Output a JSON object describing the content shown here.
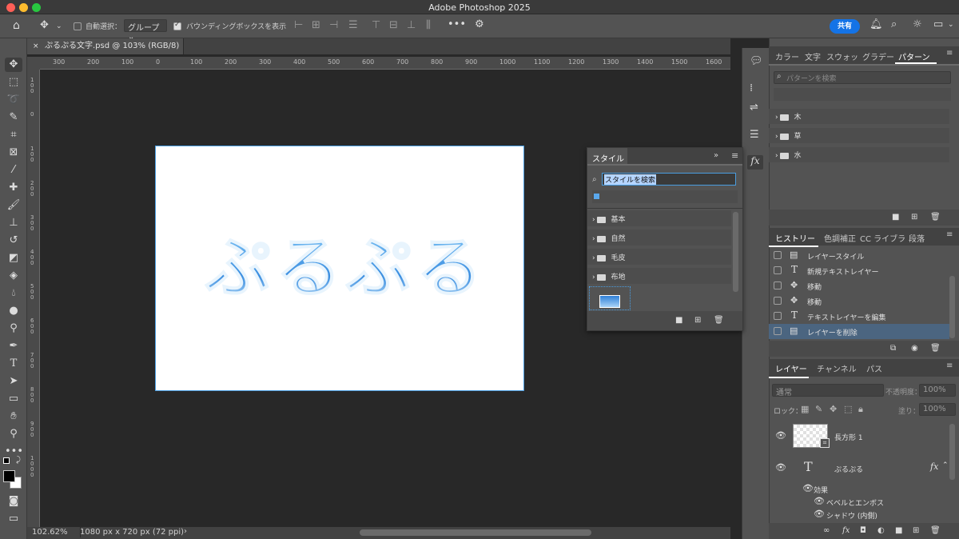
{
  "app": {
    "title": "Adobe Photoshop 2025"
  },
  "options": {
    "auto_select": "自動選択：",
    "group": "グループ",
    "bbox": "バウンディングボックスを表示",
    "share": "共有"
  },
  "document": {
    "tab": "ぷるぷる文字.psd @ 103% (RGB/8) *",
    "text": "ぷるぷる"
  },
  "ruler": {
    "h": [
      "300",
      "200",
      "100",
      "0",
      "100",
      "200",
      "300",
      "400",
      "500",
      "600",
      "700",
      "800",
      "900",
      "1000",
      "1100",
      "1200",
      "1300",
      "1400",
      "1500",
      "1600"
    ],
    "v": [
      "100",
      "0",
      "100",
      "200",
      "300",
      "400",
      "500",
      "600",
      "700",
      "800",
      "900",
      "1000"
    ]
  },
  "status": {
    "zoom": "102.62%",
    "size": "1080 px x 720 px (72 ppi)",
    "arrow": "›"
  },
  "styles_panel": {
    "title": "スタイル",
    "search": "スタイルを検索",
    "folders": [
      "基本",
      "自然",
      "毛皮",
      "布地"
    ]
  },
  "patterns_panel": {
    "tabs": [
      "カラー",
      "文字",
      "スウォッ",
      "グラデー",
      "パターン"
    ],
    "search_placeholder": "パターンを検索",
    "folders": [
      "木",
      "草",
      "水"
    ]
  },
  "history_panel": {
    "tabs": [
      "ヒストリー",
      "色調補正",
      "CC ライブラ",
      "段落"
    ],
    "items": [
      "レイヤースタイル",
      "新規テキストレイヤー",
      "移動",
      "移動",
      "テキストレイヤーを編集",
      "レイヤーを削除"
    ]
  },
  "layers_panel": {
    "tabs": [
      "レイヤー",
      "チャンネル",
      "パス"
    ],
    "blend": "通常",
    "opacity_label": "不透明度：",
    "opacity": "100%",
    "lock_label": "ロック：",
    "fill_label": "塗り：",
    "fill": "100%",
    "layers": [
      "長方形 1",
      "ぷるぷる"
    ],
    "effects_label": "効果",
    "effects": [
      "ベベルとエンボス",
      "シャドウ (内側)"
    ],
    "fx": "fx"
  },
  "colors": {
    "accent": "#1473e6",
    "history_selected": "#4b6580",
    "canvas_border": "#4a9de0"
  }
}
